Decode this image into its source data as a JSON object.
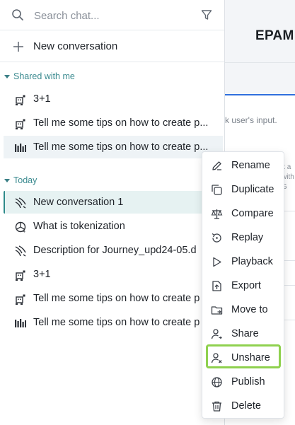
{
  "background": {
    "title": "EPAM",
    "input_hint": "k user's input.",
    "fragments": [
      "it a",
      "with",
      "G"
    ]
  },
  "sidebar": {
    "search_placeholder": "Search chat...",
    "new_conversation": "New conversation",
    "shared_section": {
      "label": "Shared with me",
      "items": [
        {
          "label": "3+1",
          "icon": "robot-icon"
        },
        {
          "label": "Tell me some tips on how to create p...",
          "icon": "robot-icon"
        },
        {
          "label": "Tell me some tips on how to create p...",
          "icon": "bar-logo-icon"
        }
      ]
    },
    "today_section": {
      "label": "Today",
      "items": [
        {
          "label": "New conversation 1",
          "icon": "wave-icon",
          "active": true
        },
        {
          "label": "What is tokenization",
          "icon": "openai-icon"
        },
        {
          "label": "Description for Journey_upd24-05.d",
          "icon": "wave-icon"
        },
        {
          "label": "3+1",
          "icon": "robot-icon"
        },
        {
          "label": "Tell me some tips on how to create p",
          "icon": "robot-icon"
        },
        {
          "label": "Tell me some tips on how to create p",
          "icon": "bar-logo-icon"
        }
      ]
    }
  },
  "context_menu": {
    "items": [
      {
        "label": "Rename",
        "icon": "pencil-icon"
      },
      {
        "label": "Duplicate",
        "icon": "duplicate-icon"
      },
      {
        "label": "Compare",
        "icon": "scale-icon"
      },
      {
        "label": "Replay",
        "icon": "replay-icon"
      },
      {
        "label": "Playback",
        "icon": "play-icon"
      },
      {
        "label": "Export",
        "icon": "export-icon"
      },
      {
        "label": "Move to",
        "icon": "folder-icon"
      },
      {
        "label": "Share",
        "icon": "share-user-icon"
      },
      {
        "label": "Unshare",
        "icon": "unshare-user-icon",
        "highlighted": true
      },
      {
        "label": "Publish",
        "icon": "globe-icon"
      },
      {
        "label": "Delete",
        "icon": "trash-icon"
      }
    ]
  },
  "colors": {
    "accent": "#2e8a8a",
    "active_bg": "#e6f2f2",
    "highlight_outline": "#8fd14f",
    "tab_underline": "#2f6fde"
  }
}
